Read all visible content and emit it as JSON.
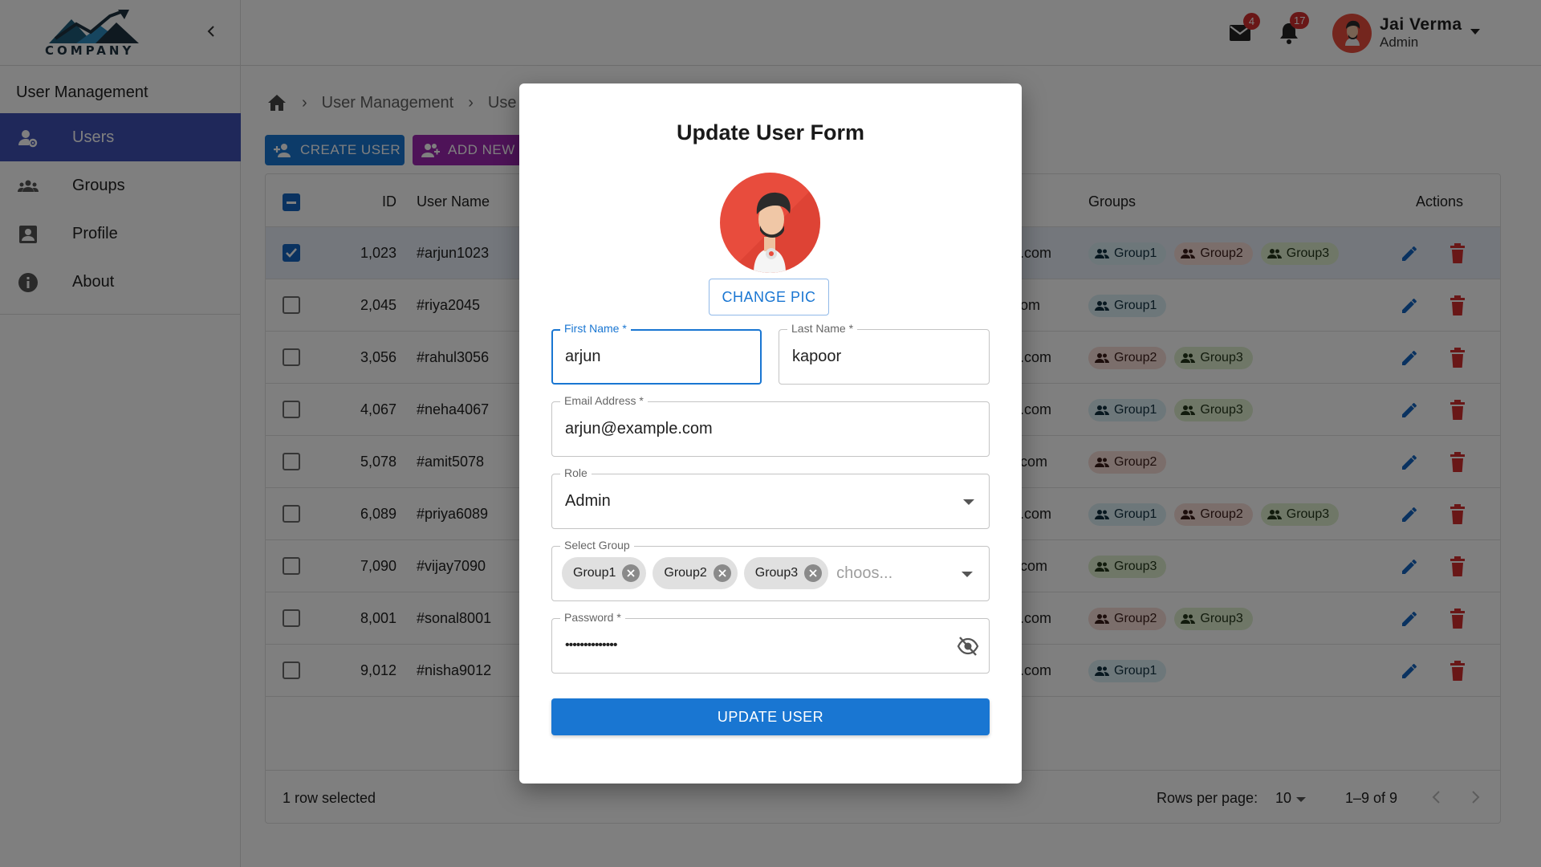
{
  "brand": {
    "name": "COMPANY"
  },
  "sidebar": {
    "section_title": "User Management",
    "items": [
      {
        "label": "Users",
        "icon": "users-gear-icon",
        "active": true
      },
      {
        "label": "Groups",
        "icon": "groups-icon"
      },
      {
        "label": "Profile",
        "icon": "profile-icon"
      },
      {
        "label": "About",
        "icon": "info-icon"
      }
    ]
  },
  "topbar": {
    "mail_count": "4",
    "notif_count": "17",
    "user_name": "Jai Verma",
    "user_role": "Admin"
  },
  "breadcrumb": {
    "items": [
      "User Management",
      "Use"
    ]
  },
  "toolbar": {
    "create_label": "CREATE USER",
    "add_label": "ADD NEW G"
  },
  "table": {
    "headers": {
      "id": "ID",
      "username": "User Name",
      "groups": "Groups",
      "actions": "Actions"
    },
    "rows": [
      {
        "id": "1,023",
        "username": "#arjun1023",
        "email_tail": ".com",
        "groups": [
          "Group1",
          "Group2",
          "Group3"
        ],
        "selected": true
      },
      {
        "id": "2,045",
        "username": "#riya2045",
        "email_tail": "om",
        "groups": [
          "Group1"
        ],
        "selected": false
      },
      {
        "id": "3,056",
        "username": "#rahul3056",
        "email_tail": ".com",
        "groups": [
          "Group2",
          "Group3"
        ],
        "selected": false
      },
      {
        "id": "4,067",
        "username": "#neha4067",
        "email_tail": ".com",
        "groups": [
          "Group1",
          "Group3"
        ],
        "selected": false
      },
      {
        "id": "5,078",
        "username": "#amit5078",
        "email_tail": "com",
        "groups": [
          "Group2"
        ],
        "selected": false
      },
      {
        "id": "6,089",
        "username": "#priya6089",
        "email_tail": ".com",
        "groups": [
          "Group1",
          "Group2",
          "Group3"
        ],
        "selected": false
      },
      {
        "id": "7,090",
        "username": "#vijay7090",
        "email_tail": "com",
        "groups": [
          "Group3"
        ],
        "selected": false
      },
      {
        "id": "8,001",
        "username": "#sonal8001",
        "email_tail": ".com",
        "groups": [
          "Group2",
          "Group3"
        ],
        "selected": false
      },
      {
        "id": "9,012",
        "username": "#nisha9012",
        "email_tail": ".com",
        "groups": [
          "Group1"
        ],
        "selected": false
      }
    ],
    "footer": {
      "selected_text": "1 row selected",
      "rows_per_page_label": "Rows per page:",
      "rows_per_page": "10",
      "range": "1–9 of 9"
    }
  },
  "modal": {
    "title": "Update User Form",
    "change_pic_label": "CHANGE PIC",
    "first_name": {
      "label": "First Name *",
      "value": "arjun"
    },
    "last_name": {
      "label": "Last Name *",
      "value": "kapoor"
    },
    "email": {
      "label": "Email Address *",
      "value": "arjun@example.com"
    },
    "role": {
      "label": "Role",
      "value": "Admin"
    },
    "groups": {
      "label": "Select Group",
      "selected": [
        "Group1",
        "Group2",
        "Group3"
      ],
      "placeholder": "choos..."
    },
    "password": {
      "label": "Password *",
      "masked": "••••••••••••••"
    },
    "submit_label": "UPDATE USER"
  },
  "colors": {
    "primary": "#1976d2",
    "nav_active": "#3f51b5",
    "add_button": "#9c27b0",
    "danger": "#d32f2f",
    "avatar": "#e84c3d"
  }
}
